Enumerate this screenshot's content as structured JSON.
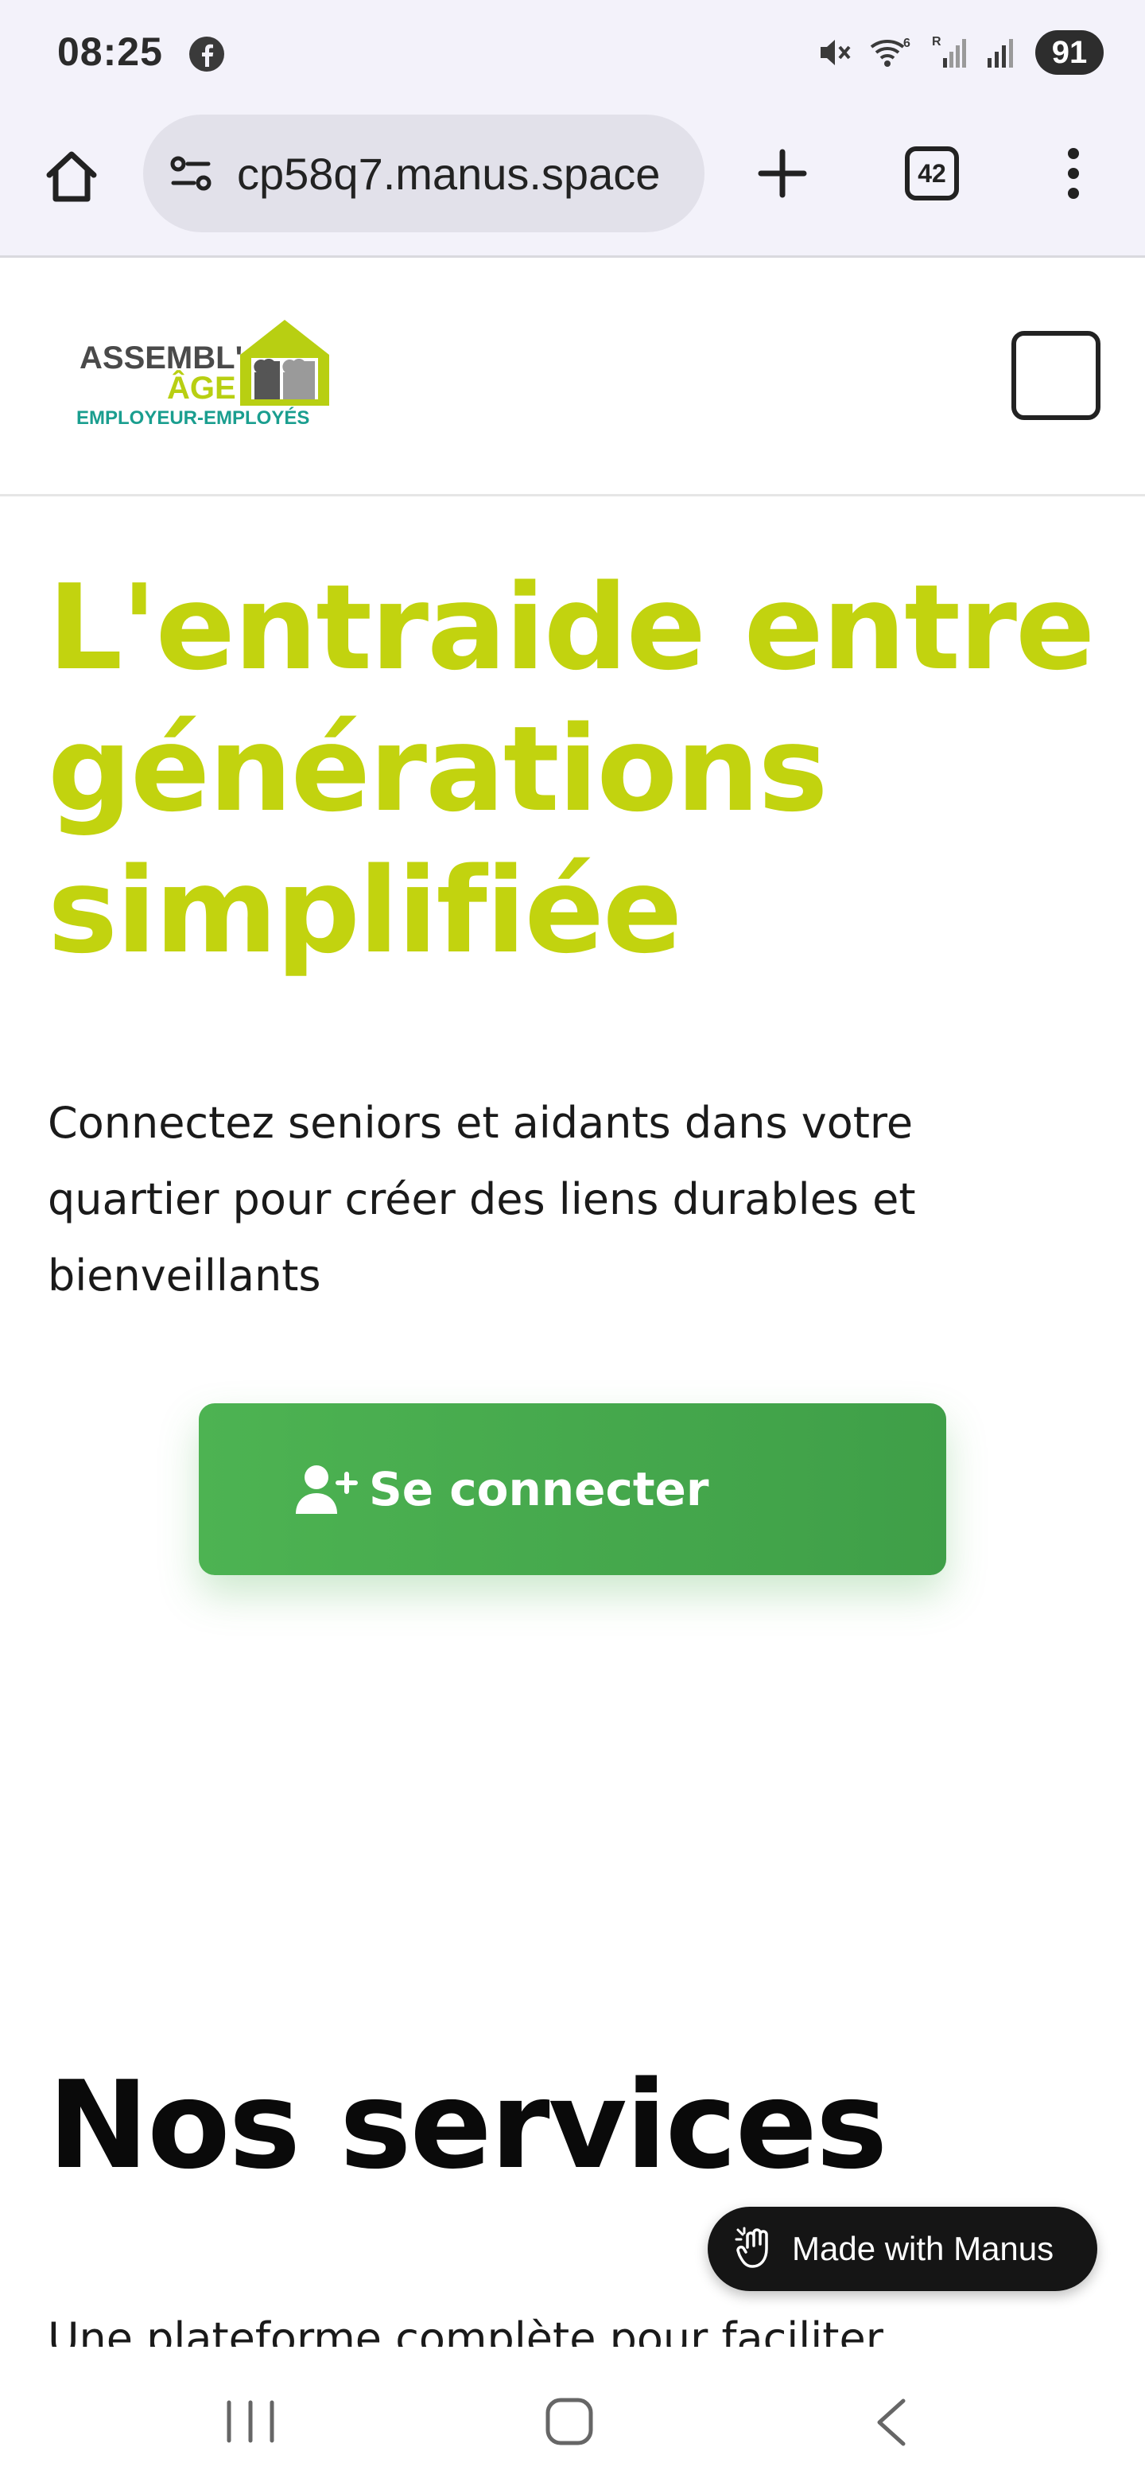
{
  "status_bar": {
    "time": "08:25",
    "battery": "91",
    "icons": [
      "facebook-icon",
      "mute-icon",
      "wifi-icon",
      "signal-icon",
      "signal-icon"
    ]
  },
  "browser": {
    "url": "cp58q7.manus.space",
    "tab_count": "42"
  },
  "header": {
    "logo": {
      "line1": "ASSEMBL'",
      "line2": "ÂGE",
      "tagline": "EMPLOYEUR-EMPLOYÉS"
    }
  },
  "hero": {
    "title": "L'entraide entre générations simplifiée",
    "subtitle": "Connectez seniors et aidants dans votre quartier pour créer des liens durables et bienveillants",
    "cta_label": "Se connecter"
  },
  "services": {
    "title": "Nos services",
    "subtitle": "Une plateforme complète pour faciliter"
  },
  "badge": {
    "label": "Made with Manus"
  },
  "colors": {
    "brand_lime": "#c2d30f",
    "cta_green": "#4caf50",
    "brand_teal": "#1a9e8f"
  }
}
